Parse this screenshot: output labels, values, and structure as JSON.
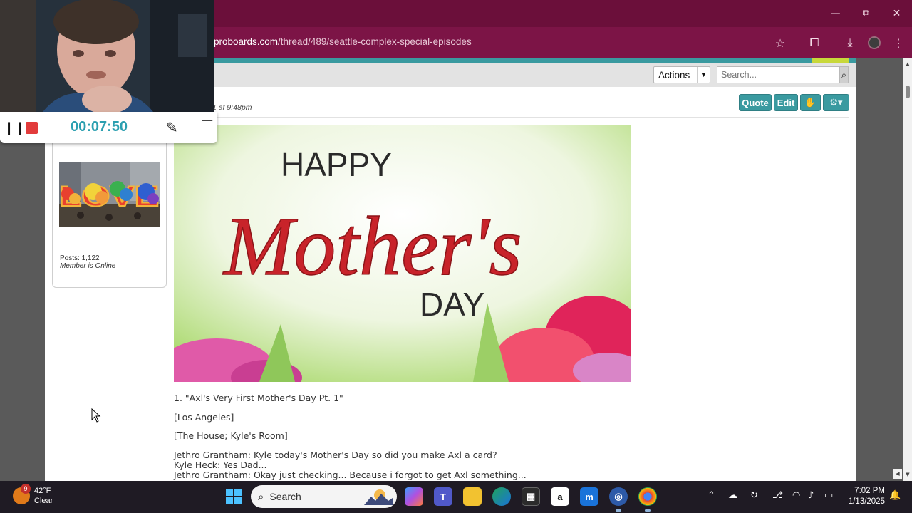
{
  "browser": {
    "url_host": "proboards.com",
    "url_path": "/thread/489/seattle-complex-special-episodes"
  },
  "forum": {
    "actions_label": "Actions",
    "search_placeholder": "Search...",
    "post_date": "1 at 9:48pm",
    "buttons": {
      "quote": "Quote",
      "edit": "Edit"
    },
    "profile": {
      "posts": "Posts: 1,122",
      "status": "Member is Online",
      "avatar_text": "LOVE"
    },
    "image": {
      "line1": "HAPPY",
      "line2": "Mother's",
      "line3": "DAY"
    },
    "body": {
      "title": "1. \"Axl's Very First Mother's Day Pt. 1\"",
      "location": "[Los Angeles]",
      "scene": "[The House; Kyle's Room]",
      "line1": "Jethro Grantham: Kyle today's Mother's Day so did you make Axl a card?",
      "line2": "Kyle Heck: Yes Dad...",
      "line3": "Jethro Grantham: Okay just checking... Because i forgot to get Axl something..."
    }
  },
  "recorder": {
    "time": "00:07:50"
  },
  "taskbar": {
    "weather_temp": "42°F",
    "weather_cond": "Clear",
    "weather_badge": "9",
    "search_label": "Search",
    "time": "7:02 PM",
    "date": "1/13/2025"
  },
  "icons": {
    "minimize": "minimize-icon",
    "restore": "restore-icon",
    "close": "close-icon",
    "star": "star-icon",
    "extensions": "puzzle-icon",
    "download": "download-icon",
    "menu": "kebab-menu-icon"
  },
  "colors": {
    "chrome_titlebar": "#6b0f3a",
    "chrome_toolbar": "#7c1446",
    "forum_accent": "#3a9aa0",
    "timer": "#2b9fb0"
  }
}
